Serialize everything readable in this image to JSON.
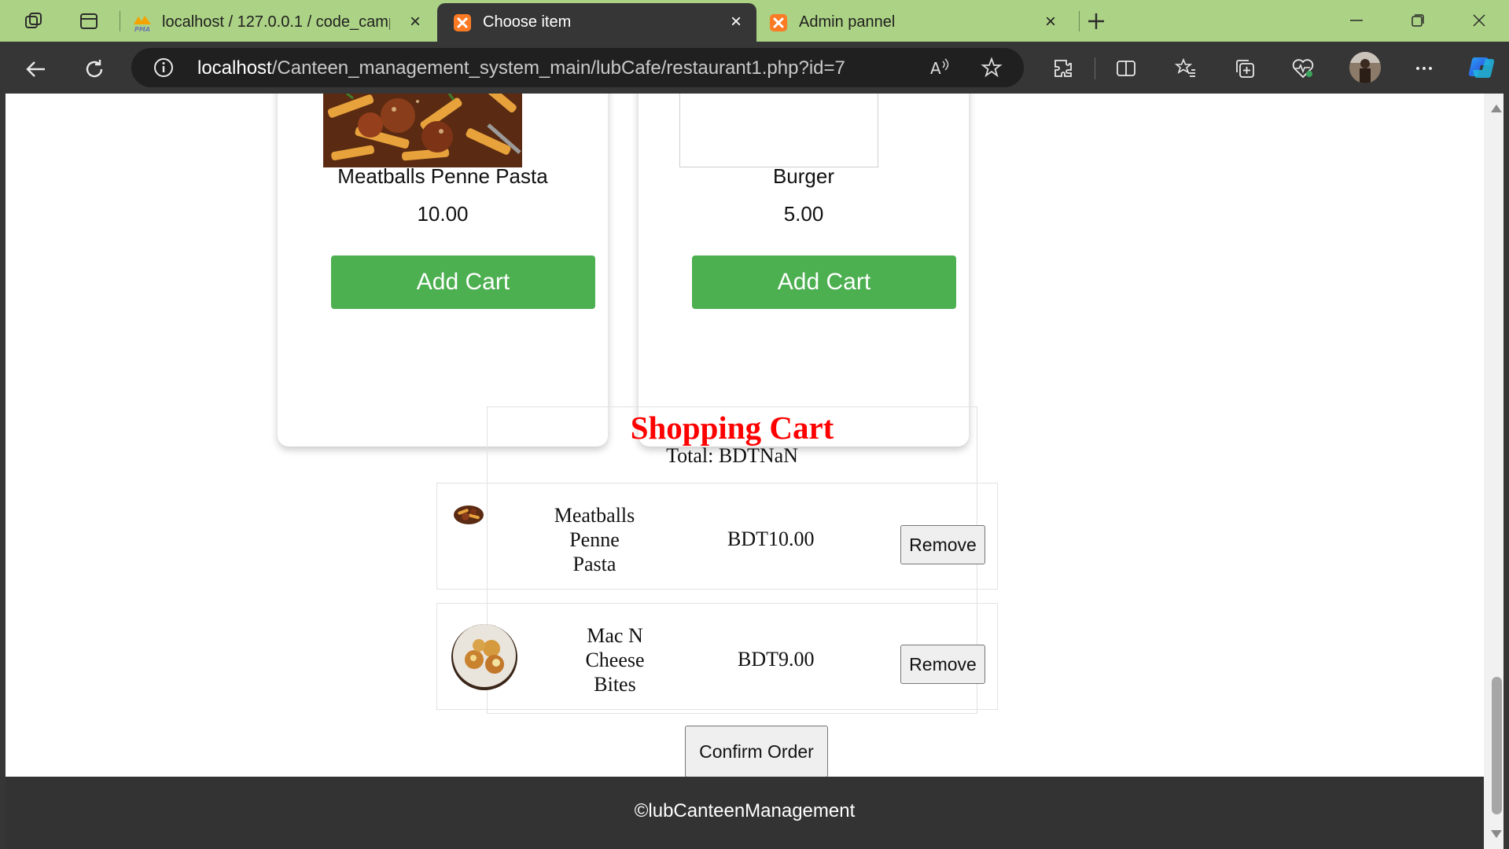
{
  "browser": {
    "tabs": [
      {
        "title": "localhost / 127.0.0.1 / code_camp",
        "favicon": "phpmyadmin-icon",
        "active": false
      },
      {
        "title": "Choose item",
        "favicon": "xampp-icon",
        "active": true
      },
      {
        "title": "Admin pannel",
        "favicon": "xampp-icon",
        "active": false
      }
    ],
    "address": {
      "host": "localhost",
      "path": "/Canteen_management_system_main/lubCafe/restaurant1.php?id=7"
    },
    "colors": {
      "tabbar": "#acd285",
      "toolbar": "#363636"
    }
  },
  "menu": {
    "items": [
      {
        "name": "Meatballs Penne Pasta",
        "price": "10.00",
        "button": "Add Cart"
      },
      {
        "name": "Burger",
        "price": "5.00",
        "button": "Add Cart"
      }
    ]
  },
  "cart": {
    "title": "Shopping Cart",
    "total": "Total: BDTNaN",
    "rows": [
      {
        "name": "Meatballs Penne Pasta",
        "price": "BDT10.00",
        "button": "Remove"
      },
      {
        "name": "Mac N Cheese Bites",
        "price": "BDT9.00",
        "button": "Remove"
      }
    ],
    "confirm": "Confirm Order"
  },
  "footer": {
    "copyright": "©lubCanteenManagement"
  },
  "colors": {
    "accent_green": "#4caf50",
    "cart_title": "#ff0000",
    "footer": "#333333"
  }
}
